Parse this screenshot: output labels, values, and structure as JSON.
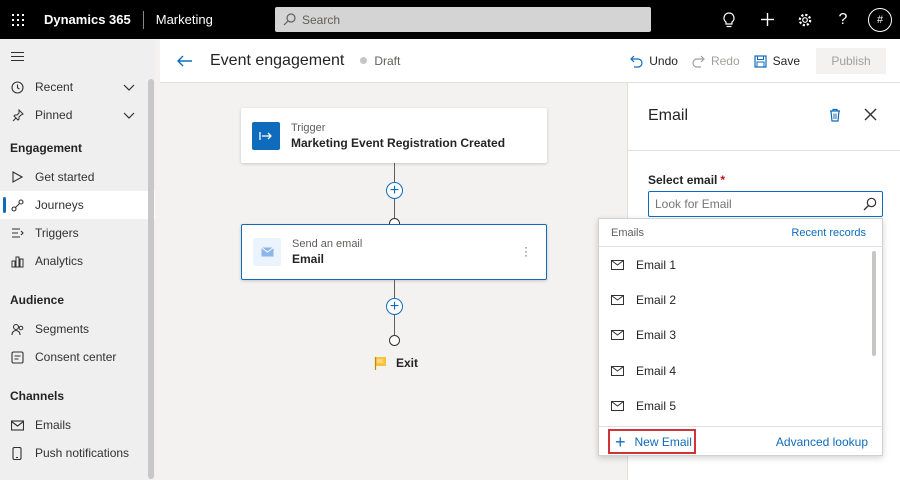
{
  "topbar": {
    "brand": "Dynamics 365",
    "app_name": "Marketing",
    "search_placeholder": "Search",
    "avatar_initial": "#"
  },
  "sidebar": {
    "items_top": [
      {
        "label": "Recent"
      },
      {
        "label": "Pinned"
      }
    ],
    "groups": [
      {
        "title": "Engagement",
        "items": [
          {
            "label": "Get started"
          },
          {
            "label": "Journeys",
            "active": true
          },
          {
            "label": "Triggers"
          },
          {
            "label": "Analytics"
          }
        ]
      },
      {
        "title": "Audience",
        "items": [
          {
            "label": "Segments"
          },
          {
            "label": "Consent center"
          }
        ]
      },
      {
        "title": "Channels",
        "items": [
          {
            "label": "Emails"
          },
          {
            "label": "Push notifications"
          }
        ]
      }
    ]
  },
  "header": {
    "title": "Event engagement",
    "status": "Draft",
    "undo": "Undo",
    "redo": "Redo",
    "save": "Save",
    "publish": "Publish"
  },
  "canvas": {
    "trigger": {
      "small": "Trigger",
      "main": "Marketing Event Registration Created"
    },
    "email": {
      "small": "Send an email",
      "main": "Email"
    },
    "exit": "Exit"
  },
  "panel": {
    "title": "Email",
    "field_label": "Select email",
    "required_mark": "*",
    "lookup_placeholder": "Look for Email"
  },
  "dropdown": {
    "header_left": "Emails",
    "header_right": "Recent records",
    "items": [
      "Email 1",
      "Email 2",
      "Email 3",
      "Email 4",
      "Email 5"
    ],
    "new_email": "New Email",
    "advanced_lookup": "Advanced lookup"
  },
  "colors": {
    "accent": "#0f6cbd",
    "highlight_border": "#d13438",
    "topbar": "#000000"
  }
}
